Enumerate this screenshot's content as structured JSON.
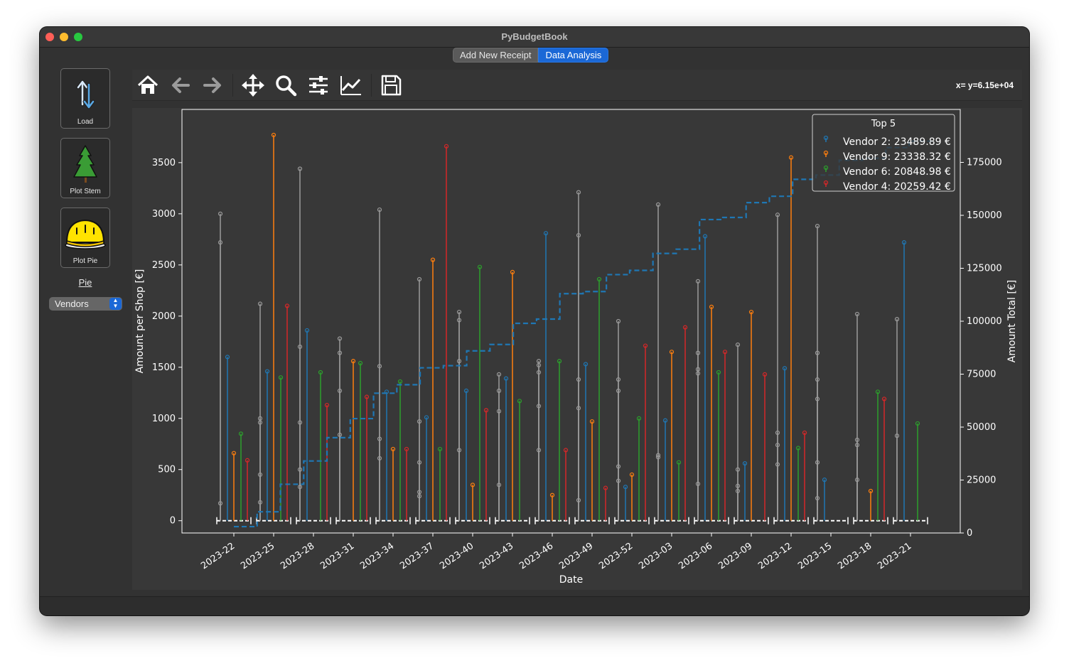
{
  "window": {
    "title": "PyBudgetBook"
  },
  "tabs": [
    {
      "label": "Add New Receipt",
      "active": false
    },
    {
      "label": "Data Analysis",
      "active": true
    }
  ],
  "sidebar": {
    "buttons": [
      {
        "label": "Load",
        "icon": "load-arrows-icon"
      },
      {
        "label": "Plot Stem",
        "icon": "tree-icon"
      },
      {
        "label": "Plot Pie",
        "icon": "pie-icon"
      }
    ],
    "section_label": "Pie",
    "select": {
      "value": "Vendors"
    }
  },
  "toolbar": {
    "icons": [
      "home-icon",
      "back-arrow-icon",
      "forward-arrow-icon",
      "pan-icon",
      "zoom-icon",
      "configure-subplots-icon",
      "edit-axis-icon",
      "save-icon"
    ],
    "coordinates": "x= y=6.15e+04"
  },
  "colors": {
    "vendor_2": "#1f77b4",
    "vendor_9": "#ff7f0e",
    "vendor_6": "#2ca02c",
    "vendor_4": "#d62728",
    "others": "#9a9a9a",
    "axes_bg": "#383838",
    "text": "#ffffff"
  },
  "chart_data": {
    "type": "stem",
    "xlabel": "Date",
    "ylabel_left": "Amount per Shop [€]",
    "ylabel_right": "Amount Total [€]",
    "ylim_left": [
      -120,
      4020
    ],
    "ylim_right": [
      0,
      200000
    ],
    "yticks_left": [
      0,
      500,
      1000,
      1500,
      2000,
      2500,
      3000,
      3500
    ],
    "yticks_right": [
      0,
      25000,
      50000,
      75000,
      100000,
      125000,
      150000,
      175000
    ],
    "yticklabels_right": [
      "0",
      "25000",
      "50000",
      "75000",
      "100000",
      "125000",
      "150000",
      "175000"
    ],
    "xticks": [
      "2023-22",
      "2023-25",
      "2023-28",
      "2023-31",
      "2023-34",
      "2023-37",
      "2023-40",
      "2023-43",
      "2023-46",
      "2023-49",
      "2023-52",
      "2023-03",
      "2023-06",
      "2023-09",
      "2023-12",
      "2023-15",
      "2023-18",
      "2023-21"
    ],
    "legend": {
      "title": "Top 5",
      "position": "top-right",
      "entries": [
        "Vendor 2: 23489.89 €",
        "Vendor 9: 23338.32 €",
        "Vendor 6: 20848.98 €",
        "Vendor 4: 20259.42 €"
      ]
    },
    "groups": [
      {
        "x": 0,
        "others": [
          3000,
          2720,
          170
        ],
        "v2": 1600,
        "v9": 660,
        "v6": 850,
        "v4": 590
      },
      {
        "x": 1,
        "others": [
          2120,
          1000,
          960,
          450,
          180
        ],
        "v2": 1460,
        "v9": 3770,
        "v6": 1400,
        "v4": 2100
      },
      {
        "x": 2,
        "others": [
          3440,
          1700,
          960,
          500,
          330
        ],
        "v2": 1860,
        "v9": null,
        "v6": 1450,
        "v4": 1130
      },
      {
        "x": 3,
        "others": [
          1780,
          1640,
          1270,
          840
        ],
        "v2": null,
        "v9": 1560,
        "v6": 1540,
        "v4": 1210
      },
      {
        "x": 4,
        "others": [
          3040,
          1510,
          800,
          610
        ],
        "v2": 1260,
        "v9": 700,
        "v6": 1360,
        "v4": 700
      },
      {
        "x": 5,
        "others": [
          2360,
          970,
          570,
          280,
          240
        ],
        "v2": 1010,
        "v9": 2550,
        "v6": 700,
        "v4": 3660
      },
      {
        "x": 6,
        "others": [
          2040,
          1960,
          1560,
          690
        ],
        "v2": 1270,
        "v9": 350,
        "v6": 2480,
        "v4": 1080
      },
      {
        "x": 7,
        "others": [
          1430,
          1270,
          1070,
          350
        ],
        "v2": 1390,
        "v9": 2430,
        "v6": 1170,
        "v4": null
      },
      {
        "x": 8,
        "others": [
          1560,
          1520,
          1450,
          1120,
          690
        ],
        "v2": 2810,
        "v9": 250,
        "v6": 1560,
        "v4": 690
      },
      {
        "x": 9,
        "others": [
          3210,
          2790,
          1380,
          1100,
          200
        ],
        "v2": 1530,
        "v9": 970,
        "v6": 2360,
        "v4": 320
      },
      {
        "x": 10,
        "others": [
          1950,
          1380,
          1270,
          530,
          390
        ],
        "v2": 330,
        "v9": 450,
        "v6": 1000,
        "v4": 1710
      },
      {
        "x": 11,
        "others": [
          3090,
          640,
          620
        ],
        "v2": 980,
        "v9": 1650,
        "v6": 570,
        "v4": 1890
      },
      {
        "x": 12,
        "others": [
          2340,
          1640,
          1480,
          1440,
          360
        ],
        "v2": 2780,
        "v9": 2090,
        "v6": 1450,
        "v4": 1650
      },
      {
        "x": 13,
        "others": [
          1720,
          500,
          340,
          290
        ],
        "v2": 560,
        "v9": 2040,
        "v6": null,
        "v4": 1430
      },
      {
        "x": 14,
        "others": [
          2990,
          860,
          740,
          550
        ],
        "v2": 1490,
        "v9": 3550,
        "v6": 710,
        "v4": 860
      },
      {
        "x": 15,
        "others": [
          2880,
          1640,
          1380,
          1190,
          570,
          220
        ],
        "v2": 400,
        "v9": null,
        "v6": null,
        "v4": null
      },
      {
        "x": 16,
        "others": [
          2020,
          790,
          740,
          400
        ],
        "v2": null,
        "v9": 290,
        "v6": 1260,
        "v4": 1190
      },
      {
        "x": 17,
        "others": [
          1970,
          830
        ],
        "v2": 2720,
        "v9": null,
        "v6": 950,
        "v4": null
      }
    ],
    "cumulative_total": [
      3000,
      10000,
      23000,
      34000,
      45000,
      54000,
      66000,
      70000,
      78000,
      79000,
      86000,
      89000,
      99000,
      101000,
      113000,
      114000,
      122000,
      124000,
      132000,
      134000,
      148000,
      149000,
      156000,
      159000,
      167000,
      169000,
      176000,
      177000,
      182000,
      185000
    ]
  }
}
